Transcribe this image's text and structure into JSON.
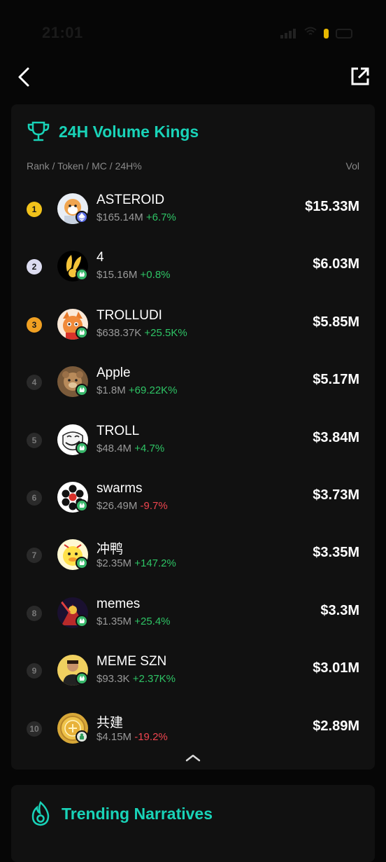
{
  "status": {
    "time": "21:01",
    "colors": {
      "battery_dot": "#e8b800"
    }
  },
  "nav": {
    "back_icon": "chevron-left-icon",
    "share_icon": "external-link-icon"
  },
  "volume_kings": {
    "title": "24H Volume Kings",
    "icon": "trophy-icon",
    "accent": "#19d3b8",
    "column_left": "Rank / Token / MC / 24H%",
    "column_right": "Vol",
    "rows": [
      {
        "rank": "1",
        "name": "ASTEROID",
        "mc": "$165.14M",
        "change": "+6.7%",
        "vol": "$15.33M",
        "rank_style": "gold",
        "chain": "eth",
        "avatar": "dog-astronaut"
      },
      {
        "rank": "2",
        "name": "4",
        "mc": "$15.16M",
        "change": "+0.8%",
        "vol": "$6.03M",
        "rank_style": "silver",
        "chain": "green",
        "avatar": "bunny"
      },
      {
        "rank": "3",
        "name": "TROLLUDI",
        "mc": "$638.37K",
        "change": "+25.5K%",
        "vol": "$5.85M",
        "rank_style": "bronze",
        "chain": "green",
        "avatar": "cat"
      },
      {
        "rank": "4",
        "name": "Apple",
        "mc": "$1.8M",
        "change": "+69.22K%",
        "vol": "$5.17M",
        "rank_style": "plain",
        "chain": "green",
        "avatar": "bear"
      },
      {
        "rank": "5",
        "name": "TROLL",
        "mc": "$48.4M",
        "change": "+4.7%",
        "vol": "$3.84M",
        "rank_style": "plain",
        "chain": "green",
        "avatar": "trollface"
      },
      {
        "rank": "6",
        "name": "swarms",
        "mc": "$26.49M",
        "change": "-9.7%",
        "vol": "$3.73M",
        "rank_style": "plain",
        "chain": "green",
        "avatar": "hexagons"
      },
      {
        "rank": "7",
        "name": "冲鸭",
        "mc": "$2.35M",
        "change": "+147.2%",
        "vol": "$3.35M",
        "rank_style": "plain",
        "chain": "green",
        "avatar": "duck"
      },
      {
        "rank": "8",
        "name": "memes",
        "mc": "$1.35M",
        "change": "+25.4%",
        "vol": "$3.3M",
        "rank_style": "plain",
        "chain": "green",
        "avatar": "hero"
      },
      {
        "rank": "9",
        "name": "MEME SZN",
        "mc": "$93.3K",
        "change": "+2.37K%",
        "vol": "$3.01M",
        "rank_style": "plain",
        "chain": "green",
        "avatar": "man"
      },
      {
        "rank": "10",
        "name": "共建",
        "mc": "$4.15M",
        "change": "-19.2%",
        "vol": "$2.89M",
        "rank_style": "plain",
        "chain": "light",
        "avatar": "coin"
      }
    ],
    "collapse_icon": "chevron-up-icon"
  },
  "trending": {
    "title": "Trending Narratives",
    "icon": "flame-icon"
  }
}
